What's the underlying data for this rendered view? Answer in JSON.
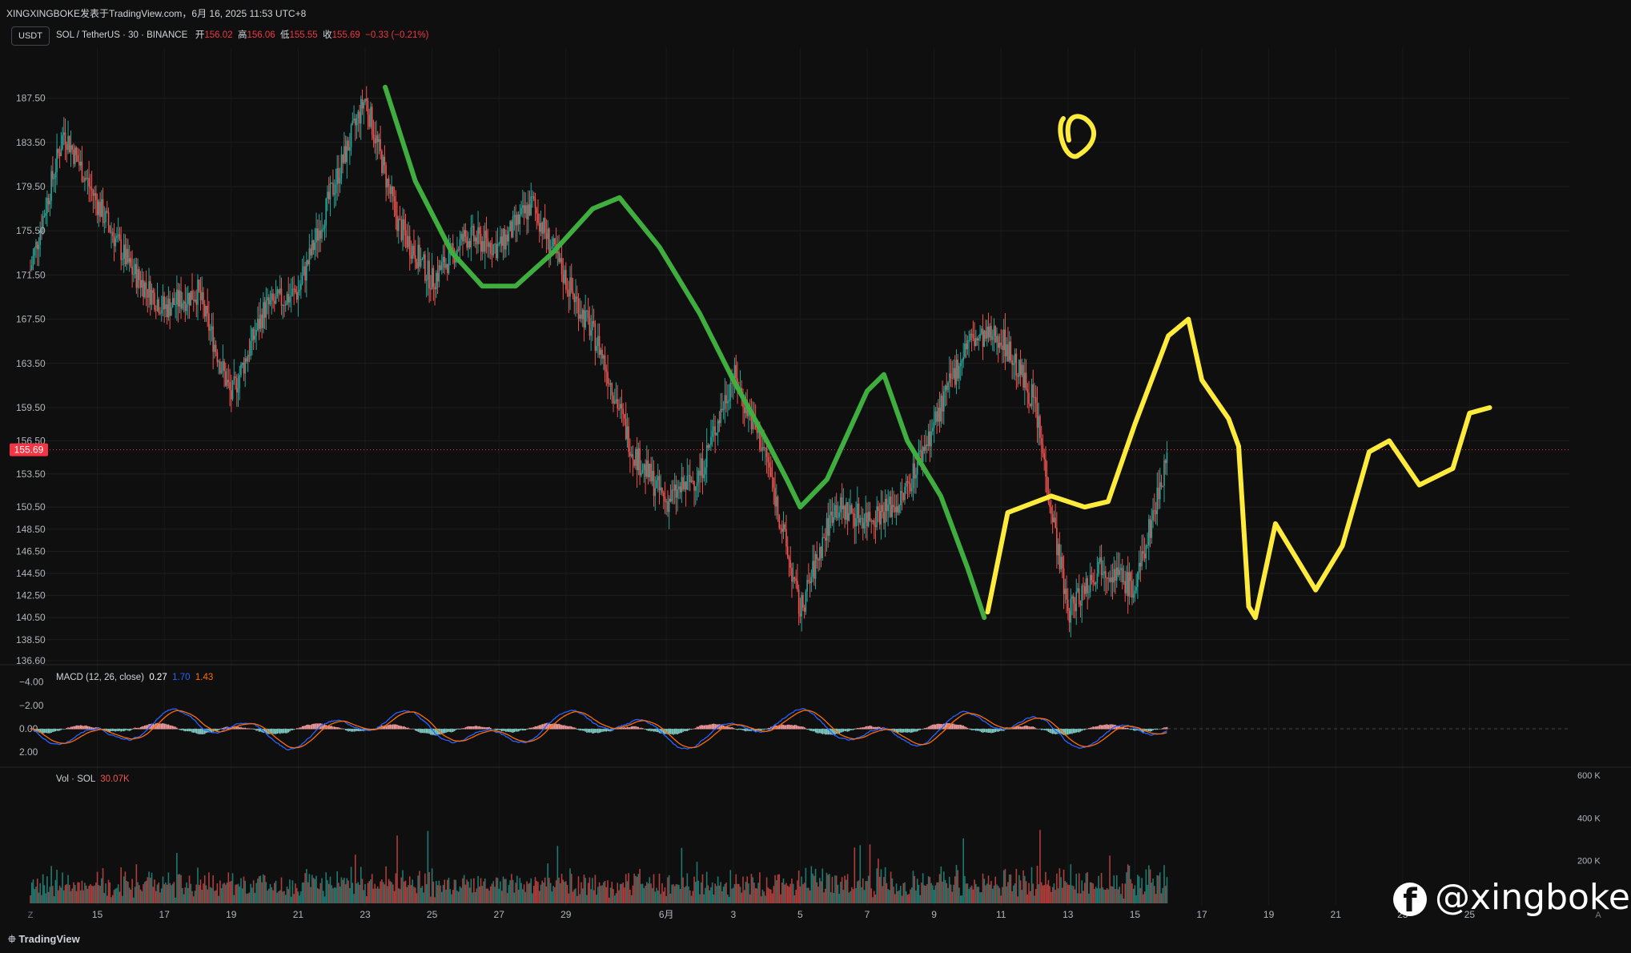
{
  "header": {
    "title": "XINGXINGBOKE发表于TradingView.com，6月 16, 2025 11:53 UTC+8"
  },
  "symbol_badge": "USDT",
  "legend": {
    "symbol": "SOL / TetherUS · 30 · BINANCE",
    "open_label": "开",
    "open": "156.02",
    "high_label": "高",
    "high": "156.06",
    "low_label": "低",
    "low": "155.55",
    "close_label": "收",
    "close": "155.69",
    "change": "−0.33 (−0.21%)"
  },
  "macd_legend": {
    "name": "MACD (12, 26, close)",
    "hist": "0.27",
    "macd": "1.70",
    "signal": "1.43"
  },
  "vol_legend": {
    "name": "Vol · SOL",
    "value": "30.07K"
  },
  "footer": {
    "brand": "TradingView",
    "brand_icon": "tradingview-logo-icon",
    "z_button": "Z",
    "a_button": "A"
  },
  "watermark": {
    "text": "@xingboke",
    "icon": "facebook-icon"
  },
  "colors": {
    "up": "#26a69a",
    "down": "#ef5350",
    "green_drawing": "#3fae3f",
    "yellow_drawing": "#ffeb3b",
    "macd_line": "#2962ff",
    "signal_line": "#ff6d00",
    "price_label": "#f23645"
  },
  "chart_data": [
    {
      "type": "line",
      "title": "SOL / TetherUS · 30 · BINANCE",
      "x_ticks": [
        "15",
        "17",
        "19",
        "21",
        "23",
        "25",
        "27",
        "29",
        "6月",
        "3",
        "5",
        "7",
        "9",
        "11",
        "13",
        "15",
        "17",
        "19",
        "21",
        "23",
        "25"
      ],
      "y_ticks": [
        "187.50",
        "183.50",
        "179.50",
        "175.50",
        "171.50",
        "167.50",
        "163.50",
        "159.50",
        "156.50",
        "153.50",
        "150.50",
        "148.50",
        "146.50",
        "144.50",
        "142.50",
        "140.50",
        "138.50",
        "136.60"
      ],
      "ylim": [
        136.6,
        189.5
      ],
      "current_price": "155.69",
      "price_path": {
        "x": [
          "2025-05-13",
          "2025-05-14",
          "2025-05-15",
          "2025-05-16",
          "2025-05-17",
          "2025-05-18",
          "2025-05-19",
          "2025-05-20",
          "2025-05-21",
          "2025-05-22",
          "2025-05-23",
          "2025-05-24",
          "2025-05-25",
          "2025-05-26",
          "2025-05-27",
          "2025-05-28",
          "2025-05-29",
          "2025-05-30",
          "2025-05-31",
          "2025-06-01",
          "2025-06-02",
          "2025-06-03",
          "2025-06-04",
          "2025-06-05",
          "2025-06-06",
          "2025-06-07",
          "2025-06-08",
          "2025-06-09",
          "2025-06-10",
          "2025-06-11",
          "2025-06-12",
          "2025-06-13",
          "2025-06-14",
          "2025-06-15",
          "2025-06-16"
        ],
        "y": [
          172.0,
          184.5,
          178.0,
          172.0,
          168.5,
          170.0,
          160.5,
          168.5,
          170.0,
          179.0,
          187.5,
          176.0,
          171.0,
          175.0,
          174.0,
          178.0,
          171.0,
          165.0,
          155.5,
          151.0,
          153.5,
          162.5,
          155.0,
          141.0,
          150.5,
          149.5,
          151.0,
          158.0,
          165.5,
          166.0,
          160.0,
          141.0,
          145.5,
          143.0,
          155.7
        ]
      },
      "drawings": [
        {
          "color": "green",
          "label": ""
        },
        {
          "color": "yellow",
          "label": ""
        }
      ]
    },
    {
      "type": "line",
      "title": "MACD (12, 26, close)",
      "y_ticks": [
        "−4.00",
        "−2.00",
        "0.00",
        "2.00"
      ],
      "ylim": [
        -4.8,
        2.6
      ],
      "series": [
        {
          "name": "MACD",
          "last": 1.7
        },
        {
          "name": "Signal",
          "last": 1.43
        },
        {
          "name": "Histogram",
          "last": 0.27
        }
      ]
    },
    {
      "type": "bar",
      "title": "Vol · SOL",
      "y_ticks": [
        "600 K",
        "400 K",
        "200 K"
      ],
      "ylim": [
        0,
        600000
      ],
      "last_value": "30.07K"
    }
  ]
}
